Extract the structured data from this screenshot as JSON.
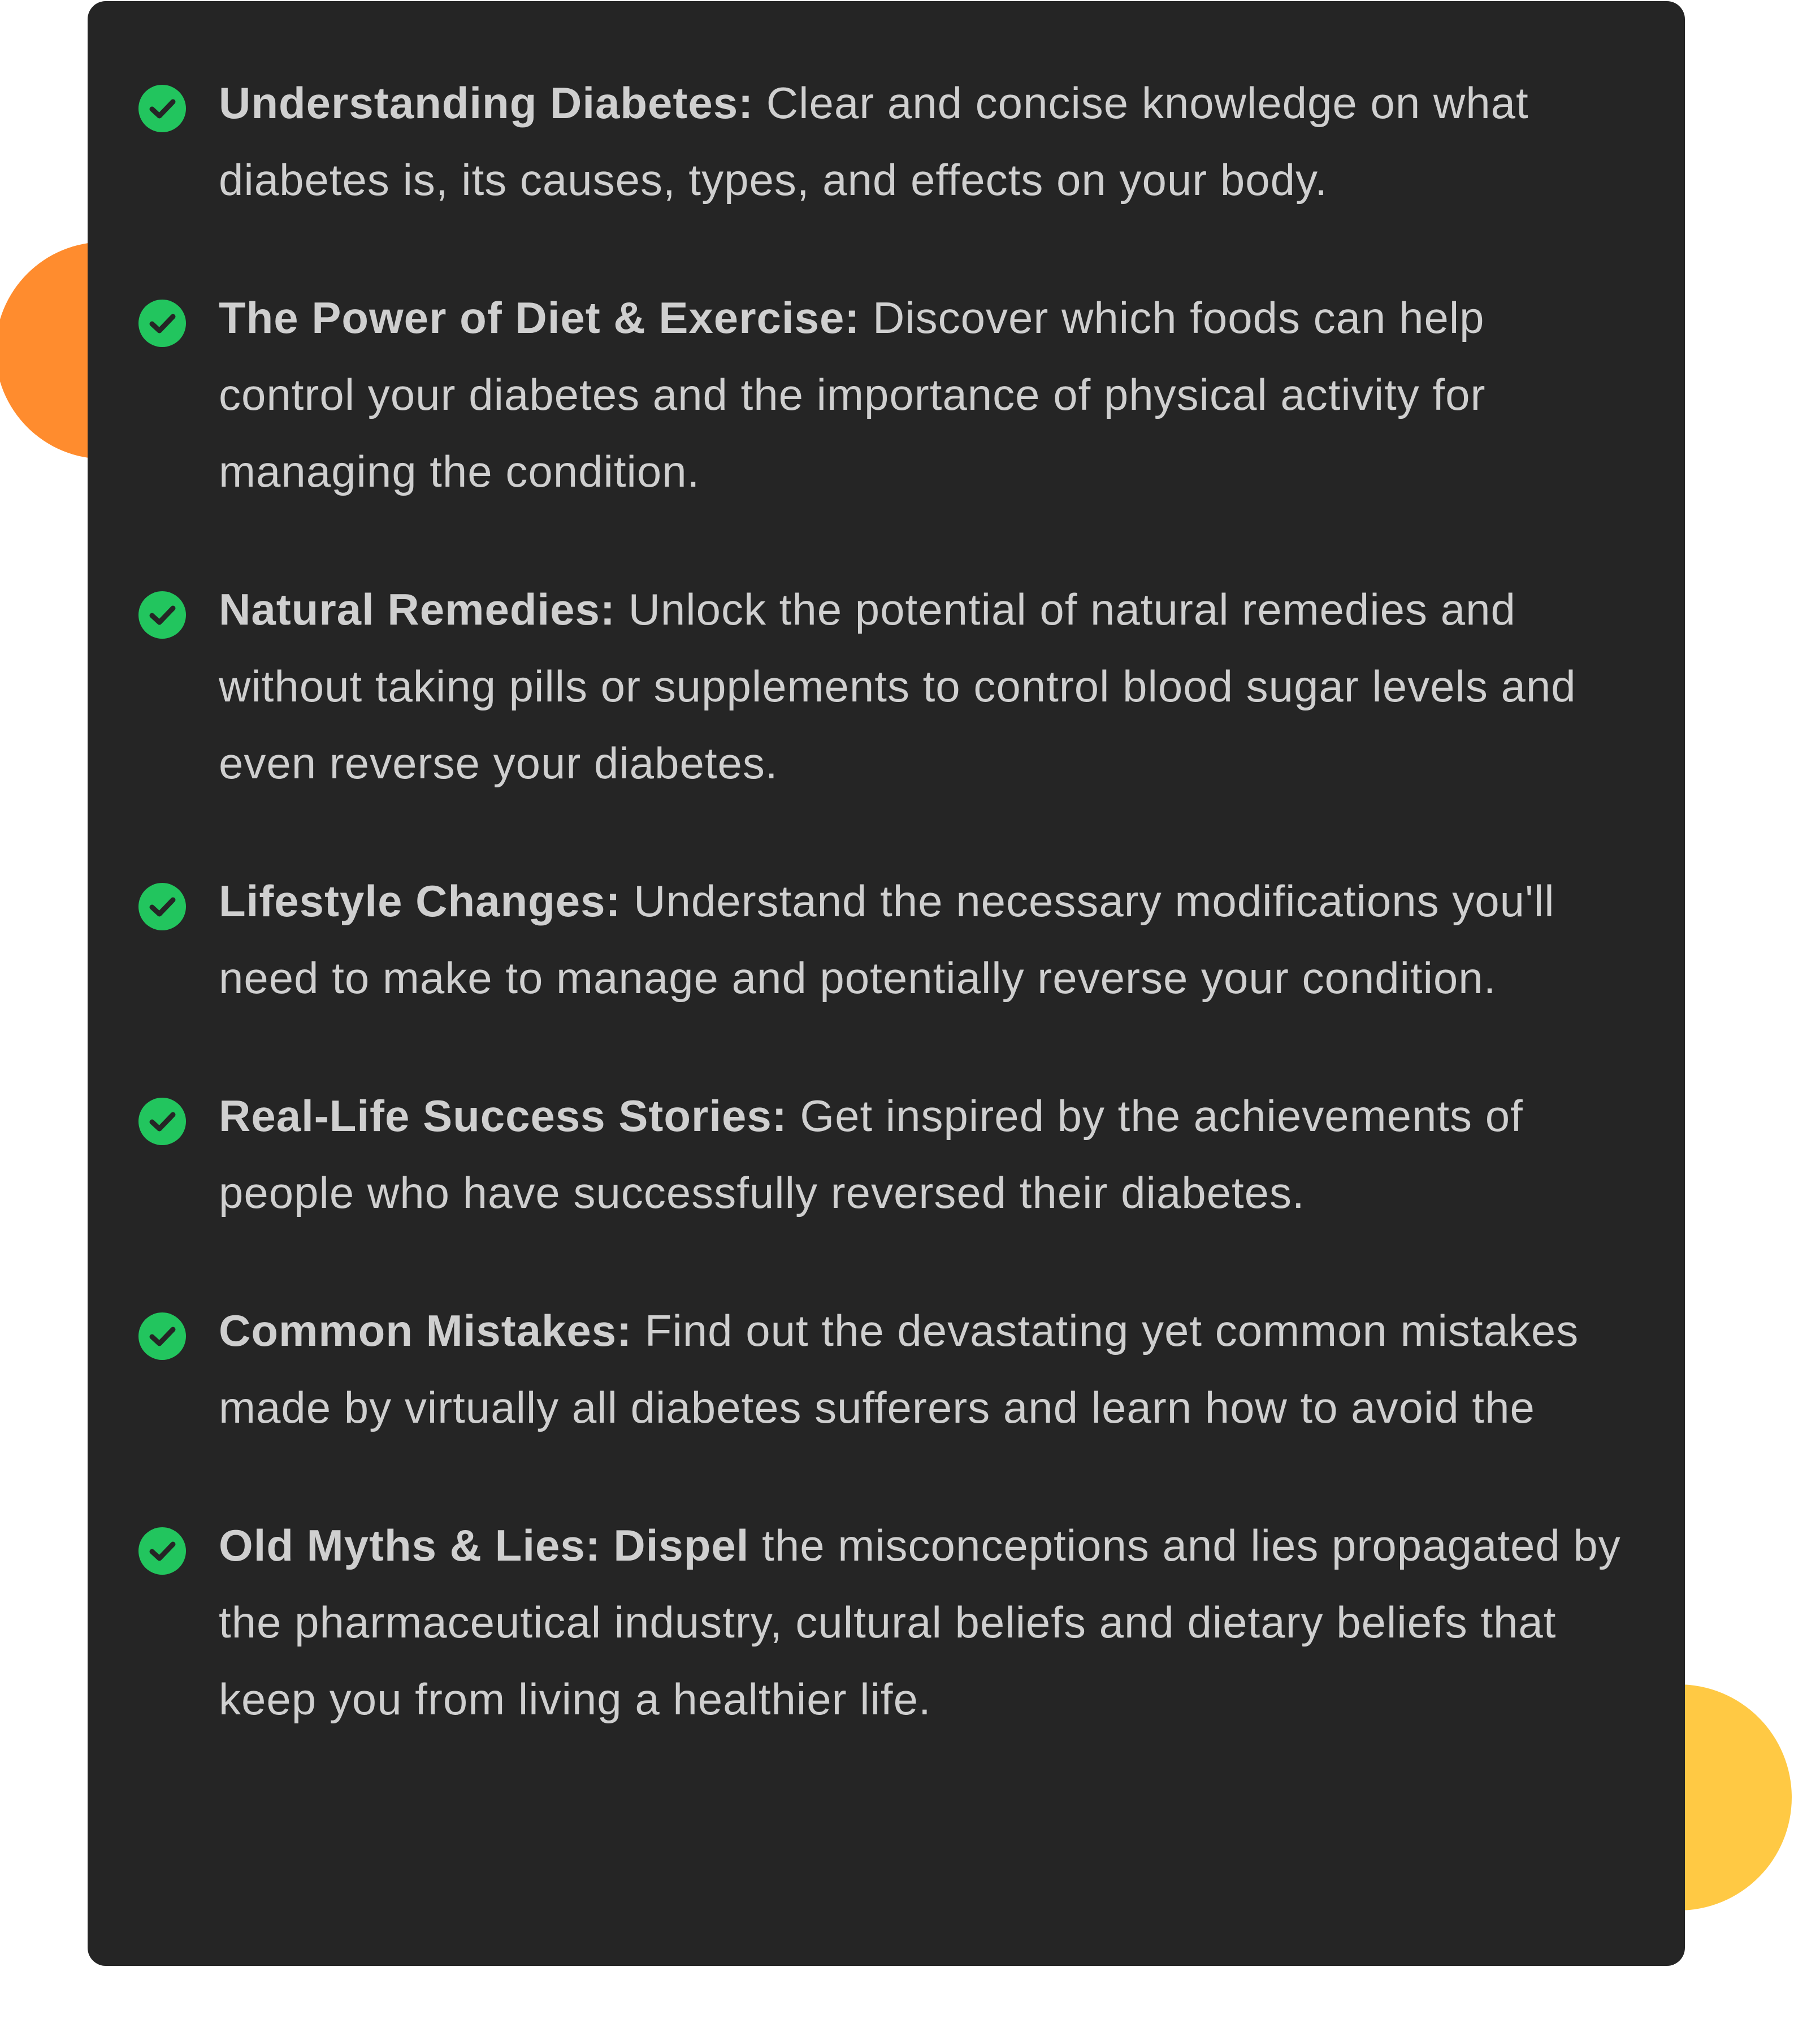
{
  "features": [
    {
      "title": "Understanding Diabetes:",
      "text": " Clear and concise knowledge on what diabetes is, its causes, types, and effects on your body.",
      "icon": "check-circle-icon"
    },
    {
      "title": "The Power of Diet & Exercise:",
      "text": " Discover which foods can help control your diabetes and the importance of physical activity for managing the condition.",
      "icon": "check-circle-icon"
    },
    {
      "title": "Natural Remedies:",
      "text": " Unlock the potential of natural remedies and without taking pills or supplements to control blood sugar levels and even reverse your diabetes.",
      "icon": "check-circle-icon"
    },
    {
      "title": "Lifestyle Changes:",
      "text": " Understand the necessary modifications you'll need to make to manage and potentially reverse your condition.",
      "icon": "check-circle-icon"
    },
    {
      "title": "Real-Life Success Stories:",
      "text": " Get inspired by the achievements of people who have successfully reversed their diabetes.",
      "icon": "check-circle-icon"
    },
    {
      "title": "Common Mistakes:",
      "text": " Find out the devastating yet common mistakes made by virtually all diabetes sufferers and learn how to avoid the",
      "icon": "check-circle-icon"
    },
    {
      "title": "Old Myths & Lies: Dispel",
      "text": " the misconceptions and lies propagated by the pharmaceutical industry, cultural beliefs and dietary beliefs that keep you from living a healthier life.",
      "icon": "check-circle-icon"
    }
  ],
  "colors": {
    "card_background": "#252525",
    "text": "#CFCFCF",
    "check": "#22C55E",
    "orange_accent": "#FF8C2E",
    "yellow_accent": "#FFC944"
  }
}
